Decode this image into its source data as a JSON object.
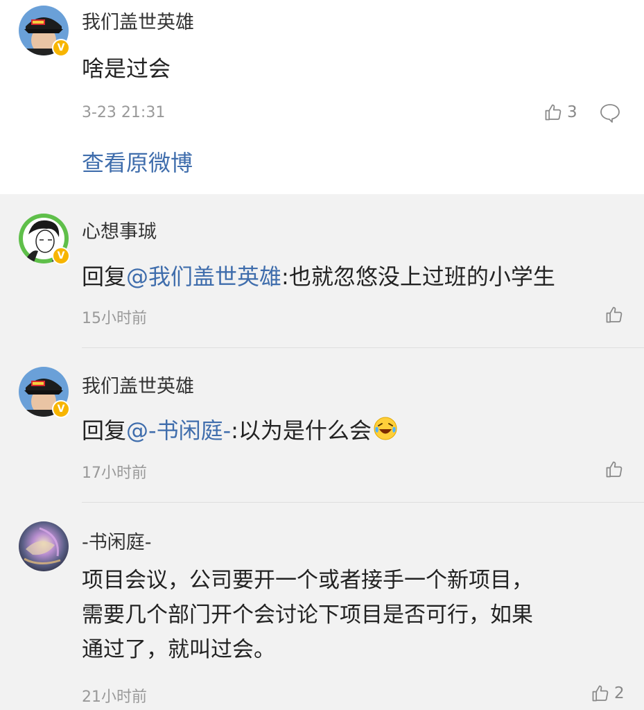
{
  "original_post": {
    "author": "我们盖世英雄",
    "text": "啥是过会",
    "time": "3-23 21:31",
    "like_count": "3",
    "view_link": "查看原微博"
  },
  "replies": [
    {
      "author": "心想事珹",
      "reply_prefix": "回复",
      "mention": "@我们盖世英雄",
      "body": ":也就忽悠没上过班的小学生",
      "time": "15小时前"
    },
    {
      "author": "我们盖世英雄",
      "reply_prefix": "回复",
      "mention": "@-书闲庭-",
      "body": ":以为是什么会",
      "emoji": "laughing-crying-emoji",
      "time": "17小时前"
    },
    {
      "author": "-书闲庭-",
      "body_lines": [
        "项目会议，公司要开一个或者接手一个新项目，",
        "需要几个部门开个会讨论下项目是否可行，如果",
        "通过了，就叫过会。"
      ],
      "time": "21小时前",
      "like_count": "2"
    }
  ],
  "verified_badge": "V",
  "colors": {
    "link": "#3f6dac",
    "badge": "#f7b500",
    "reply_bg": "#f2f2f2",
    "meta_text": "#999999"
  },
  "icons": [
    "thumbs-up-icon",
    "comment-icon",
    "verified-badge-icon"
  ]
}
